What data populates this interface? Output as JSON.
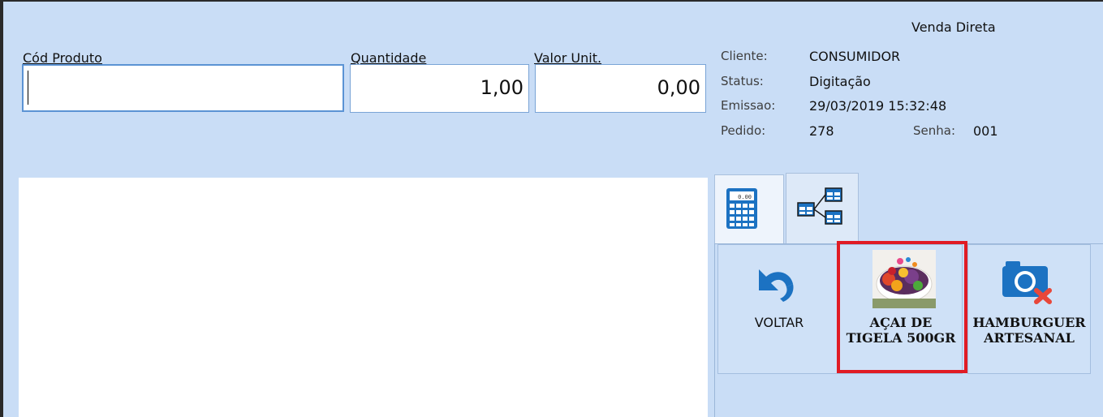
{
  "header": {
    "title": "Venda Direta"
  },
  "fields": {
    "cod_produto": {
      "label": "Cód Produto",
      "value": ""
    },
    "quantidade": {
      "label": "Quantidade",
      "value": "1,00"
    },
    "valor_unit": {
      "label": "Valor Unit.",
      "value": "0,00"
    }
  },
  "info": {
    "cliente": {
      "label": "Cliente:",
      "value": "CONSUMIDOR"
    },
    "status": {
      "label": "Status:",
      "value": "Digitação"
    },
    "emissao": {
      "label": "Emissao:",
      "value": "29/03/2019 15:32:48"
    },
    "pedido": {
      "label": "Pedido:",
      "value": "278"
    },
    "senha": {
      "label": "Senha:",
      "value": "001"
    }
  },
  "tabs": [
    {
      "icon": "calculator-icon"
    },
    {
      "icon": "table-tree-icon"
    }
  ],
  "calculator_display": "0.00",
  "tiles": [
    {
      "label_line1": "VOLTAR",
      "label_line2": "",
      "icon": "undo-arrow-icon"
    },
    {
      "label_line1": "AÇAI DE",
      "label_line2": "TIGELA 500GR",
      "icon": "acai-bowl-photo",
      "highlighted": true
    },
    {
      "label_line1": "HAMBURGUER",
      "label_line2": "ARTESANAL",
      "icon": "camera-missing-icon"
    }
  ],
  "colors": {
    "background": "#c9ddf6",
    "highlight": "#e01b24",
    "icon_blue": "#1c72c2",
    "icon_red": "#e8473a"
  }
}
